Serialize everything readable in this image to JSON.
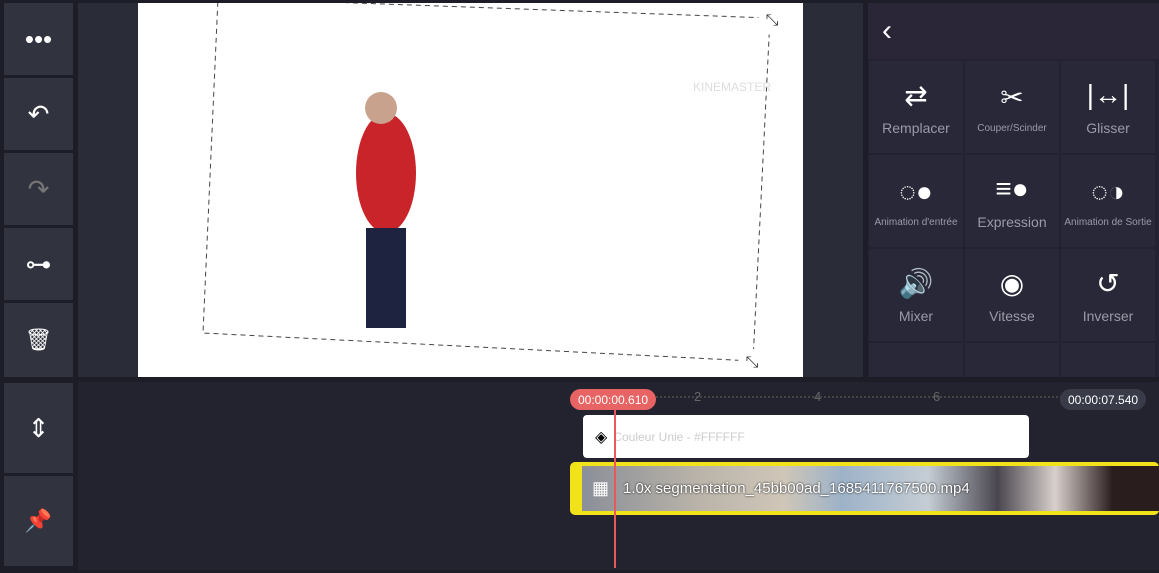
{
  "sidebar": {
    "buttons": [
      {
        "name": "more",
        "icon": "•••"
      },
      {
        "name": "undo",
        "icon": "↶"
      },
      {
        "name": "redo",
        "icon": "↷"
      },
      {
        "name": "keyframe",
        "icon": "⊶"
      },
      {
        "name": "delete",
        "icon": "🗑"
      }
    ],
    "bottom": [
      {
        "name": "track-adjust",
        "icon": "⇕"
      },
      {
        "name": "pin",
        "icon": "📌"
      }
    ]
  },
  "preview": {
    "watermark": "KINEMASTER"
  },
  "panel": {
    "back": "‹",
    "items": [
      {
        "label": "Remplacer",
        "icon": "⇄",
        "small": false
      },
      {
        "label": "Couper/Scinder",
        "icon": "✂",
        "small": true
      },
      {
        "label": "Glisser",
        "icon": "|↔|",
        "small": false
      },
      {
        "label": "Animation d'entrée",
        "icon": "◌●",
        "small": true
      },
      {
        "label": "Expression",
        "icon": "≡●",
        "small": false
      },
      {
        "label": "Animation de Sortie",
        "icon": "◌◑",
        "small": true
      },
      {
        "label": "Mixer",
        "icon": "🔊",
        "small": false
      },
      {
        "label": "Vitesse",
        "icon": "◉",
        "small": false
      },
      {
        "label": "Inverser",
        "icon": "↺",
        "small": false
      },
      {
        "label": "",
        "icon": "▭",
        "small": false
      },
      {
        "label": "",
        "icon": "⊣",
        "small": false
      },
      {
        "label": "",
        "icon": "⌂",
        "small": false
      }
    ]
  },
  "timeline": {
    "current_time": "00:00:00.610",
    "total_time": "00:00:07.540",
    "ticks": [
      "2",
      "4",
      "6"
    ],
    "color_clip": "Couleur Unie - #FFFFFF",
    "video_clip": "1.0x segmentation_45bb00ad_1685411767500.mp4"
  }
}
